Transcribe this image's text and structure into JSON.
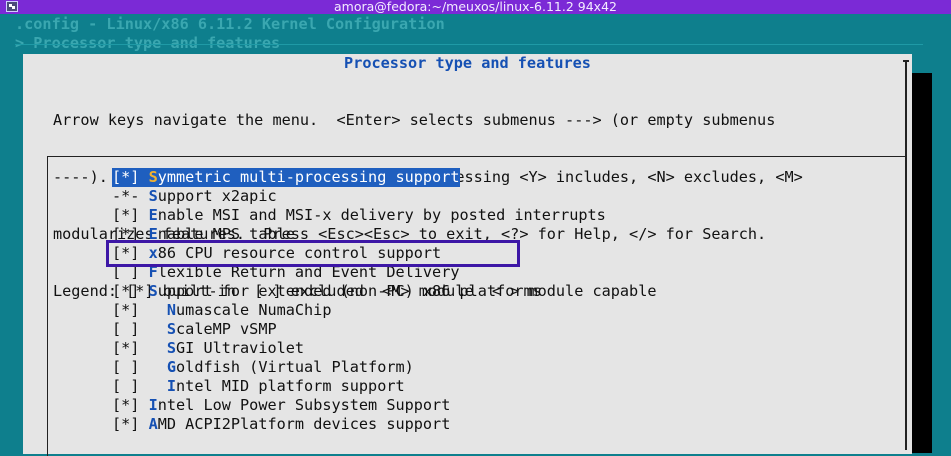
{
  "window": {
    "title": "amora@fedora:~/meuxos/linux-6.11.2 94x42"
  },
  "terminal": {
    "config_line": ".config - Linux/x86 6.11.2 Kernel Configuration",
    "breadcrumb": "> Processor type and features"
  },
  "dialog": {
    "title": "Processor type and features",
    "help_lines": [
      "Arrow keys navigate the menu.  <Enter> selects submenus ---> (or empty submenus",
      "----).  Highlighted letters are hotkeys.  Pressing <Y> includes, <N> excludes, <M>",
      "modularizes features.  Press <Esc><Esc> to exit, <?> for Help, </> for Search.",
      "Legend: [*] built-in  [ ] excluded  <M> module  < > module capable"
    ]
  },
  "menu": {
    "items": [
      {
        "box": "[*]",
        "indent": " ",
        "hotkey": "S",
        "rest": "ymmetric multi-processing support",
        "selected": true
      },
      {
        "box": "-*-",
        "indent": " ",
        "hotkey": "S",
        "rest": "upport x2apic"
      },
      {
        "box": "[*]",
        "indent": " ",
        "hotkey": "E",
        "rest": "nable MSI and MSI-x delivery by posted interrupts"
      },
      {
        "box": "[*]",
        "indent": " ",
        "hotkey": "E",
        "rest": "nable MPS table"
      },
      {
        "box": "[*]",
        "indent": " ",
        "hotkey": "x",
        "rest": "86 CPU resource control support",
        "annotated": true
      },
      {
        "box": "[ ]",
        "indent": " ",
        "hotkey": "F",
        "rest": "lexible Return and Event Delivery"
      },
      {
        "box": "[*]",
        "indent": " ",
        "hotkey": "S",
        "rest": "upport for extended (non-PC) x86 platforms"
      },
      {
        "box": "[*]",
        "indent": "   ",
        "hotkey": "N",
        "rest": "umascale NumaChip"
      },
      {
        "box": "[ ]",
        "indent": "   ",
        "hotkey": "S",
        "rest": "caleMP vSMP"
      },
      {
        "box": "[*]",
        "indent": "   ",
        "hotkey": "S",
        "rest": "GI Ultraviolet"
      },
      {
        "box": "[ ]",
        "indent": "   ",
        "hotkey": "G",
        "rest": "oldfish (Virtual Platform)"
      },
      {
        "box": "[ ]",
        "indent": "   ",
        "hotkey": "I",
        "rest": "ntel MID platform support"
      },
      {
        "box": "[*]",
        "indent": " ",
        "hotkey": "I",
        "rest": "ntel Low Power Subsystem Support"
      },
      {
        "box": "[*]",
        "indent": " ",
        "hotkey": "A",
        "rest": "MD ACPI2Platform devices support"
      }
    ]
  },
  "colors": {
    "terminal_bg": "#0e7f8d",
    "dialog_bg": "#e5e5e5",
    "hotkey": "#1550b3",
    "selection_bg": "#1f5fbf",
    "annotation_border": "#3d17a6"
  }
}
